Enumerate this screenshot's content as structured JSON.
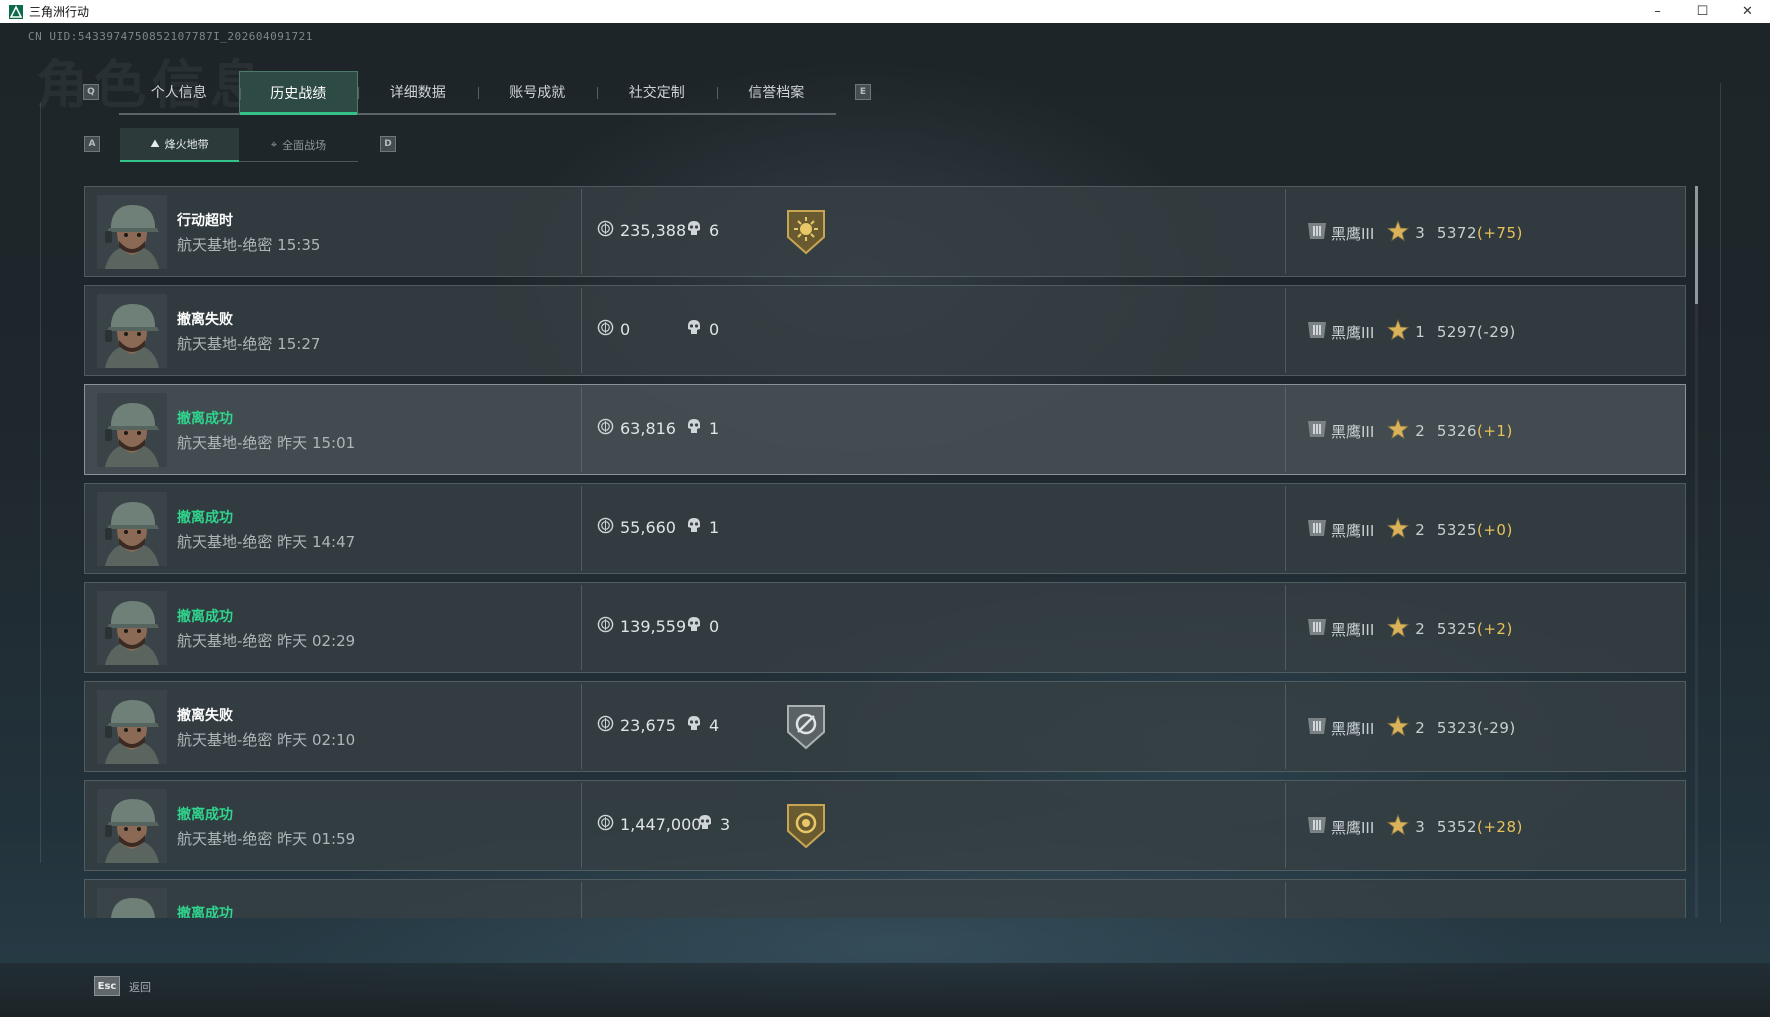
{
  "window": {
    "title": "三角洲行动",
    "minimize": "–",
    "maximize": "☐",
    "close": "✕"
  },
  "uid": "CN UID:5433974750852107787I_202604091721",
  "background_title": "角色信息",
  "keys": {
    "tab_prev": "Q",
    "tab_next": "E",
    "sub_prev": "A",
    "sub_next": "D"
  },
  "tabs": [
    {
      "label": "个人信息",
      "active": false
    },
    {
      "label": "历史战绩",
      "active": true
    },
    {
      "label": "详细数据",
      "active": false
    },
    {
      "label": "账号成就",
      "active": false
    },
    {
      "label": "社交定制",
      "active": false
    },
    {
      "label": "信誉档案",
      "active": false
    }
  ],
  "subtabs": [
    {
      "label": "烽火地带",
      "icon": "mountain-icon",
      "active": true
    },
    {
      "label": "全面战场",
      "icon": "crosshair-icon",
      "active": false
    }
  ],
  "rank_name": "黑鹰III",
  "colors": {
    "accent": "#33c28a",
    "success": "#2fd48d",
    "positive_delta": "#e8c15a",
    "star": "#d9b25a"
  },
  "matches": [
    {
      "result": "行动超时",
      "success": false,
      "location": "航天基地-绝密 15:35",
      "money": "235,388",
      "kills": "6",
      "badge": "gold-sun-badge",
      "stars": "3",
      "score": "5372",
      "delta": "(+75)",
      "delta_positive": true,
      "highlight": false
    },
    {
      "result": "撤离失败",
      "success": false,
      "location": "航天基地-绝密 15:27",
      "money": "0",
      "kills": "0",
      "badge": "",
      "stars": "1",
      "score": "5297",
      "delta": "(-29)",
      "delta_positive": false,
      "highlight": false
    },
    {
      "result": "撤离成功",
      "success": true,
      "location": "航天基地-绝密 昨天 15:01",
      "money": "63,816",
      "kills": "1",
      "badge": "",
      "stars": "2",
      "score": "5326",
      "delta": "(+1)",
      "delta_positive": true,
      "highlight": true
    },
    {
      "result": "撤离成功",
      "success": true,
      "location": "航天基地-绝密 昨天 14:47",
      "money": "55,660",
      "kills": "1",
      "badge": "",
      "stars": "2",
      "score": "5325",
      "delta": "(+0)",
      "delta_positive": true,
      "highlight": false
    },
    {
      "result": "撤离成功",
      "success": true,
      "location": "航天基地-绝密 昨天 02:29",
      "money": "139,559",
      "kills": "0",
      "badge": "",
      "stars": "2",
      "score": "5325",
      "delta": "(+2)",
      "delta_positive": true,
      "highlight": false
    },
    {
      "result": "撤离失败",
      "success": false,
      "location": "航天基地-绝密 昨天 02:10",
      "money": "23,675",
      "kills": "4",
      "badge": "silver-gear-badge",
      "stars": "2",
      "score": "5323",
      "delta": "(-29)",
      "delta_positive": false,
      "highlight": false
    },
    {
      "result": "撤离成功",
      "success": true,
      "location": "航天基地-绝密 昨天 01:59",
      "money": "1,447,000",
      "kills": "3",
      "badge": "gold-coin-badge",
      "stars": "3",
      "score": "5352",
      "delta": "(+28)",
      "delta_positive": true,
      "highlight": false
    },
    {
      "result": "撤离成功",
      "success": true,
      "location": "",
      "money": "",
      "kills": "",
      "badge": "",
      "stars": "",
      "score": "",
      "delta": "",
      "delta_positive": true,
      "highlight": false
    }
  ],
  "footer": {
    "esc_key": "Esc",
    "back_label": "返回"
  }
}
